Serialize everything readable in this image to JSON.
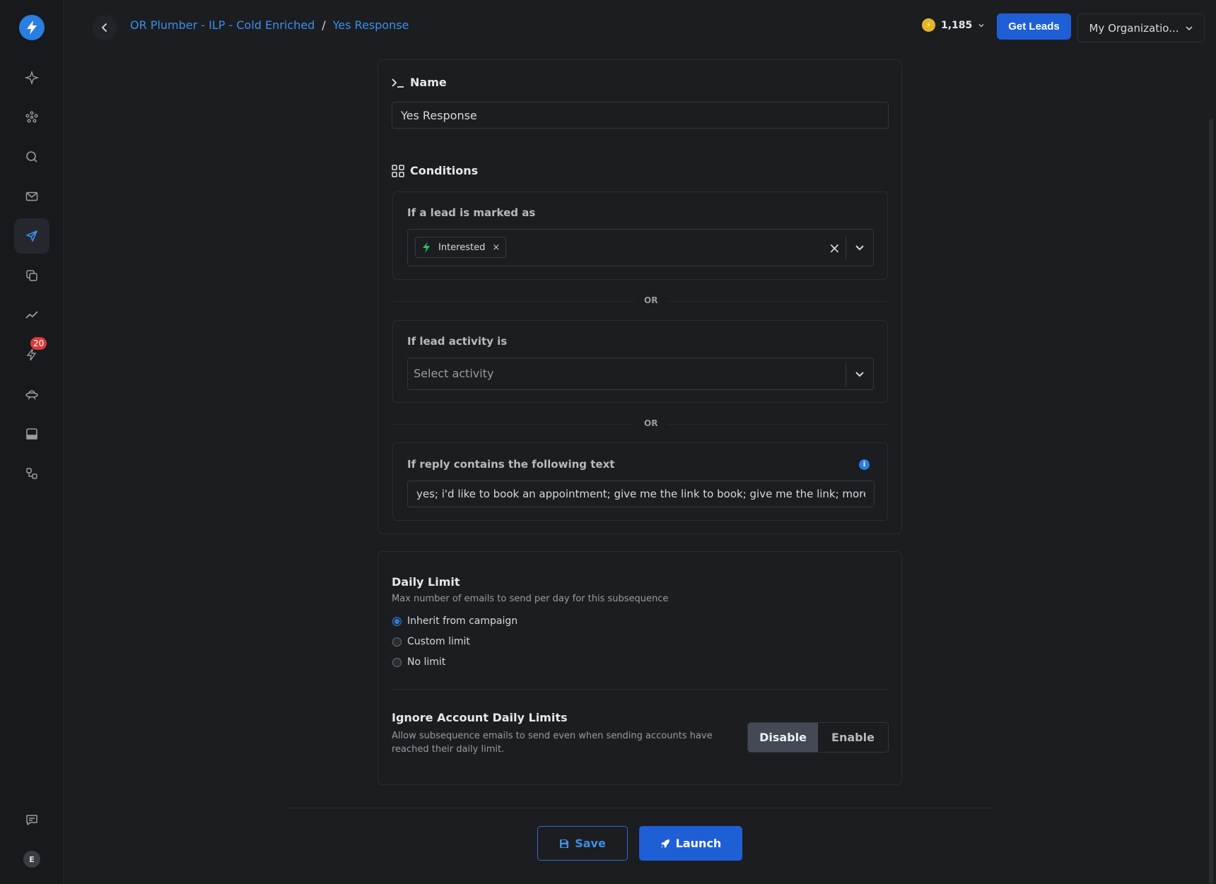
{
  "breadcrumb": {
    "campaign": "OR Plumber - ILP - Cold Enriched",
    "separator": "/",
    "current": "Yes Response"
  },
  "header": {
    "credits": "1,185",
    "get_leads_label": "Get Leads",
    "org_label": "My Organizatio..."
  },
  "sidebar": {
    "notification_count": "20",
    "avatar_initial": "E",
    "icons": [
      "sparkle-icon",
      "network-icon",
      "search-icon",
      "mail-icon",
      "send-icon",
      "copy-icon",
      "analytics-icon",
      "bolt-icon",
      "ufo-icon",
      "inbox-icon",
      "integrations-icon",
      "chat-icon"
    ],
    "active": "send-icon"
  },
  "name_section": {
    "title": "Name",
    "value": "Yes Response"
  },
  "conditions": {
    "title": "Conditions",
    "marked_as_label": "If a lead is marked as",
    "selected_status": "Interested",
    "or_label": "OR",
    "activity_label": "If lead activity is",
    "activity_placeholder": "Select activity",
    "reply_label": "If reply contains the following text",
    "reply_value": "yes; i'd like to book an appointment; give me the link to book; give me the link; more info"
  },
  "daily_limit": {
    "title": "Daily Limit",
    "description": "Max number of emails to send per day for this subsequence",
    "options": [
      "Inherit from campaign",
      "Custom limit",
      "No limit"
    ],
    "selected_index": 0
  },
  "ignore_limits": {
    "title": "Ignore Account Daily Limits",
    "description_line1": "Allow subsequence emails to send even when sending accounts have",
    "description_line2": "reached their daily limit.",
    "disable_label": "Disable",
    "enable_label": "Enable",
    "selected": "Disable"
  },
  "footer": {
    "save_label": "Save",
    "launch_label": "Launch"
  },
  "colors": {
    "accent": "#1e5fd6",
    "link": "#3d8fe8",
    "background": "#1b1d21"
  }
}
